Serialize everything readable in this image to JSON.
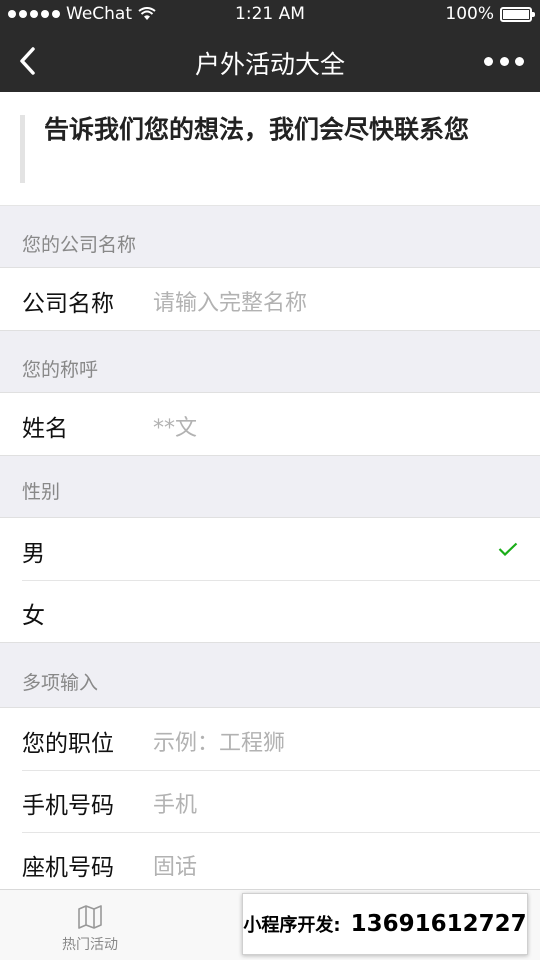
{
  "status_bar": {
    "carrier": "WeChat",
    "time": "1:21 AM",
    "battery": "100%"
  },
  "nav": {
    "title": "户外活动大全"
  },
  "intro": {
    "text": "告诉我们您的想法，我们会尽快联系您"
  },
  "sections": {
    "company": {
      "header": "您的公司名称",
      "label": "公司名称",
      "placeholder": "请输入完整名称"
    },
    "name": {
      "header": "您的称呼",
      "label": "姓名",
      "value": "**文"
    },
    "gender": {
      "header": "性别",
      "options": [
        "男",
        "女"
      ],
      "selected": "男"
    },
    "multi": {
      "header": "多项输入",
      "rows": [
        {
          "label": "您的职位",
          "placeholder": "示例：工程狮"
        },
        {
          "label": "手机号码",
          "placeholder": "手机"
        },
        {
          "label": "座机号码",
          "placeholder": "固话"
        }
      ]
    }
  },
  "tabbar": {
    "tabs": [
      {
        "label": "热门活动",
        "icon": "map-icon"
      }
    ]
  },
  "promo": {
    "label": "小程序开发:",
    "phone": "13691612727"
  },
  "colors": {
    "check": "#1aad19",
    "nav_bg": "#2b2b2b",
    "page_bg": "#efeff4"
  }
}
